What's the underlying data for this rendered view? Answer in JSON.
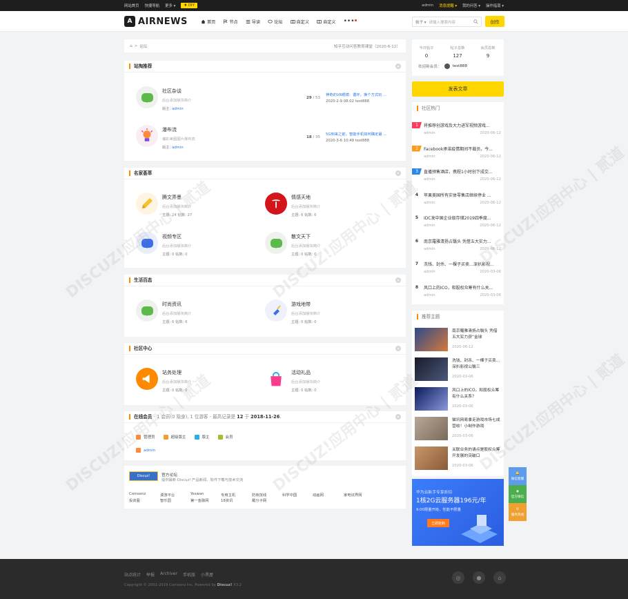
{
  "topbar": {
    "left": [
      "网站首页",
      "快捷导航",
      "更多 ▾"
    ],
    "diy": "♦ DIY",
    "user": "admin",
    "notice": "消息提醒 ▾",
    "my": "我的问答 ▾",
    "ops": "操作指南 ▾"
  },
  "header": {
    "logo": "AIRNEWS",
    "logo_mark": "A",
    "nav": [
      {
        "icon": "home-icon",
        "label": "首页"
      },
      {
        "icon": "flag-icon",
        "label": "节点"
      },
      {
        "icon": "list-icon",
        "label": "导读"
      },
      {
        "icon": "chat-icon",
        "label": "论坛"
      },
      {
        "icon": "book-icon",
        "label": "自定义"
      },
      {
        "icon": "book-icon",
        "label": "自定义"
      }
    ],
    "more": "•••",
    "search_scope": "帖子 ▾",
    "search_placeholder": "请输入搜索内容",
    "create": "创作"
  },
  "breadcrumb": {
    "home": "⌂",
    "sep": ">",
    "current": "论坛",
    "news": "知乎互动问答教育课堂（2020-6-12）"
  },
  "sections": [
    {
      "title": "站掏推荐",
      "forums": [
        {
          "name": "社区杂谈",
          "desc": "后台添加版块简介",
          "mod_label": "版主:",
          "mod": "admin",
          "icon": "chat-bubble-icon",
          "color": "#5cba4b",
          "topics": "29",
          "posts": "53",
          "last_title": "神奇的VR眼镜：循环，换个方式玩 ...",
          "last_meta": "2020-2-9 08:02 test888"
        },
        {
          "name": "瀑布流",
          "desc": "偏彩美图图片瀑布流",
          "mod_label": "版主:",
          "mod": "admin",
          "icon": "lightbulb-icon",
          "color": "#e84b8a",
          "topics": "18",
          "posts": "35",
          "last_title": "5G到来之前，智能手机如何确定最 ...",
          "last_meta": "2020-3-6 10:49 test888"
        }
      ]
    },
    {
      "title": "名家荟萃",
      "forums": [
        {
          "name": "腾文弄墨",
          "desc": "后台添加版块简介",
          "stats": "主题: 24   帖数: 27",
          "icon": "pencil-icon",
          "color": "#f5c12e"
        },
        {
          "name": "情感天地",
          "desc": "后台添加版块简介",
          "stats": "主题: 6   帖数: 6",
          "icon": "tesla-icon",
          "color": "#d4141b"
        },
        {
          "name": "视频专区",
          "desc": "后台添加版块简介",
          "stats": "主题: 0   帖数: 0",
          "icon": "chat-bubble-icon",
          "color": "#3b6fe8"
        },
        {
          "name": "散文天下",
          "desc": "后台添加版块简介",
          "stats": "主题: 0   帖数: 0",
          "icon": "chat-bubble-icon",
          "color": "#5cba4b"
        }
      ]
    },
    {
      "title": "生活百态",
      "forums": [
        {
          "name": "时尚资讯",
          "desc": "后台添加版块简介",
          "stats": "主题: 6   帖数: 6",
          "icon": "chat-bubble-icon",
          "color": "#5cba4b"
        },
        {
          "name": "游戏地带",
          "desc": "后台添加版块简介",
          "stats": "主题: 0   帖数: 0",
          "icon": "broom-icon",
          "color": "#3b6fe8"
        }
      ]
    },
    {
      "title": "社区中心",
      "forums": [
        {
          "name": "站务处理",
          "desc": "后台添加版块简介",
          "stats": "主题: 0   帖数: 0",
          "icon": "megaphone-icon",
          "color": "#ff8a00"
        },
        {
          "name": "活动礼品",
          "desc": "后台添加版块简介",
          "stats": "主题: 0   帖数: 0",
          "icon": "bag-icon",
          "color": "#ff3b8e"
        }
      ]
    }
  ],
  "online": {
    "title": "在线会员",
    "summary_pre": "- 1 会员(0 隐身), 1 位游客 - 最高记录是 ",
    "summary_count": "12",
    "summary_mid": " 于 ",
    "summary_date": "2018-11-26",
    "summary_end": ".",
    "roles": [
      "管理员",
      "超级版主",
      "版主",
      "会员"
    ],
    "users": [
      "admin"
    ]
  },
  "links": {
    "official_title": "官方论坛",
    "official_desc": "提供最新 Discuz! 产品新闻、软件下载与技术交流",
    "badge": "Discuz!",
    "items": [
      "Comsenz",
      "漫游平台",
      "Yeswan",
      "专用主机",
      "防琐技线",
      "科学中国",
      "动画网",
      "家电炫界网",
      "投资盈",
      "智乐园",
      "第一金融网",
      "18资讯",
      "戴分子网"
    ]
  },
  "stats": {
    "today_label": "今日帖子",
    "today": "0",
    "posts_label": "帖子总数",
    "posts": "127",
    "members_label": "会员总数",
    "members": "9",
    "welcome": "欢迎新会员：",
    "newest": "test888"
  },
  "post_button": "发表文章",
  "hot": {
    "title": "社区热门",
    "items": [
      {
        "rank": "1",
        "title": "将推荐创游戏及大力进军视频游戏...",
        "author": "admin",
        "date": "2020-06-12",
        "color": "#ff3b5c"
      },
      {
        "rank": "2",
        "title": "Facebook承诺疫情期间不裁员，今...",
        "author": "admin",
        "date": "2020-06-12",
        "color": "#ff9a1a"
      },
      {
        "rank": "3",
        "title": "直播预售酒店，携程1小时创下成交...",
        "author": "admin",
        "date": "2020-06-12",
        "color": "#2a88e8"
      },
      {
        "rank": "4",
        "title": "苹果美国所有实体零售店继续停业 ...",
        "author": "admin",
        "date": "2020-06-12"
      },
      {
        "rank": "5",
        "title": "IDC发中国企业级存储2019四季度...",
        "author": "admin",
        "date": "2020-06-12"
      },
      {
        "rank": "6",
        "title": "南京羅雅清扬占翳头 凭借五大实力...",
        "author": "admin",
        "date": "2020-06-12"
      },
      {
        "rank": "7",
        "title": "洗钱、封杀、一棵子买卖…深扒影视...",
        "author": "admin",
        "date": "2020-03-06"
      },
      {
        "rank": "8",
        "title": "风口上的ICO，和股权众筹有什么关...",
        "author": "admin",
        "date": "2020-03-06"
      }
    ]
  },
  "recommend": {
    "title": "推荐主题",
    "items": [
      {
        "title": "南京羅雅清扬占翳头 凭借五大实力获“金球",
        "date": "2020-06-12",
        "c1": "#2c4a8c",
        "c2": "#d47a3a"
      },
      {
        "title": "洗钱、封杀、一棵子买卖…深扒影视公翳三",
        "date": "2020-03-06",
        "c1": "#1a1a2a",
        "c2": "#4a5a7a"
      },
      {
        "title": "风口上的ICO，和股权众筹有什么关系？",
        "date": "2020-03-06",
        "c1": "#0a1a5a",
        "c2": "#8a9ade"
      },
      {
        "title": "猫讯网易拿走游戏市场七成营收！小制作游戏",
        "date": "2020-03-06",
        "c1": "#b8a898",
        "c2": "#7a6a5a"
      },
      {
        "title": "关联业务的请点是股权众筹开发展的突破口",
        "date": "2020-03-06",
        "c1": "#c89868",
        "c2": "#8a5a3a"
      }
    ]
  },
  "ad": {
    "line1": "华为云新手专享折扣",
    "line2": "1核2G云服务器196元/年",
    "line3": "9:00限量开抢，性能不限量",
    "cta": "立即抢购"
  },
  "float": [
    "微信客服",
    "官方微信",
    "服务热线"
  ],
  "footer": {
    "links": [
      "站点统计",
      "举报",
      "Archiver",
      "手机版",
      "小黑屋"
    ],
    "copy_pre": "Copyright © 2001-2019 Comsenz Inc.  Powered by ",
    "copy_brand": "Discuz!",
    "copy_ver": " X3.2"
  },
  "watermark": "DISCUZ!应用中心 | 贰道"
}
